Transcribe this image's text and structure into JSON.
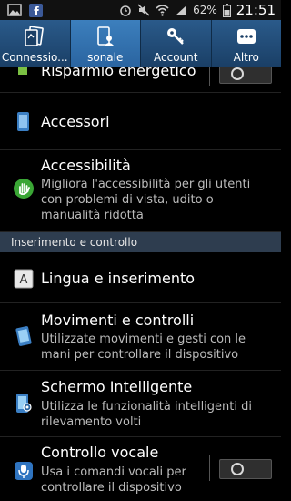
{
  "status_bar": {
    "battery": "62%",
    "time": "21:51"
  },
  "tabs": [
    {
      "label": "Connessio..."
    },
    {
      "label": "sonale"
    },
    {
      "label": "Account"
    },
    {
      "label": "Altro"
    }
  ],
  "items": {
    "risparmio": {
      "title": "Risparmio energetico",
      "toggle": "off"
    },
    "accessori": {
      "title": "Accessori"
    },
    "accessibilita": {
      "title": "Accessibilità",
      "sub": "Migliora l'accessibilità per gli utenti con problemi di vista, udito o manualità ridotta"
    },
    "section": "Inserimento e controllo",
    "lingua": {
      "title": "Lingua e inserimento"
    },
    "movimenti": {
      "title": "Movimenti e controlli",
      "sub": "Utilizzate movimenti e gesti con le mani per controllare il dispositivo"
    },
    "schermo": {
      "title": "Schermo Intelligente",
      "sub": "Utilizza le funzionalità intelligenti di rilevamento volti"
    },
    "vocale": {
      "title": "Controllo vocale",
      "sub": "Usa i comandi vocali per controllare il dispositivo",
      "toggle": "off"
    }
  },
  "colors": {
    "tab_bar": "#1a3f66",
    "tab_active": "#3c7fbd",
    "section_bg": "#2e3d4f",
    "background": "#000000"
  }
}
